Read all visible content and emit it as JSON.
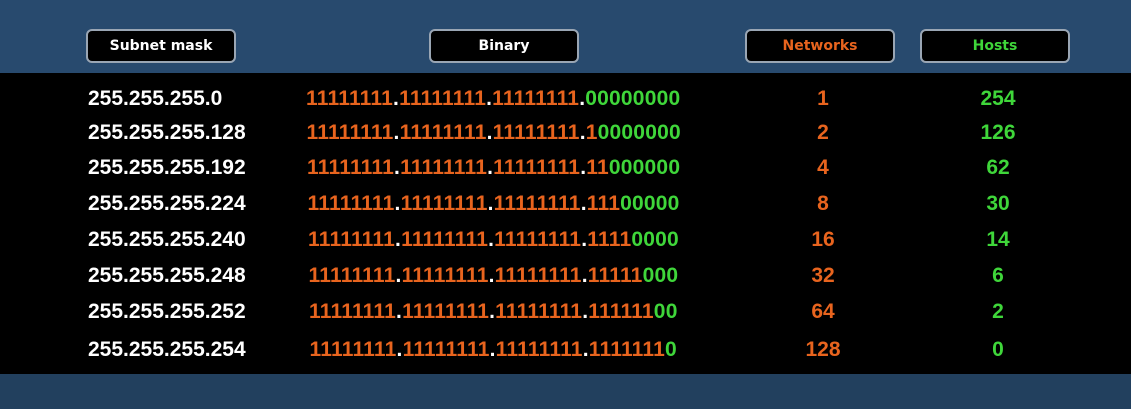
{
  "headers": {
    "mask": "Subnet mask",
    "binary": "Binary",
    "networks": "Networks",
    "hosts": "Hosts"
  },
  "colors": {
    "network_bits": "#e8641e",
    "host_bits": "#3fd63a",
    "header_bg": "#284a6e"
  },
  "rows": [
    {
      "mask": "255.255.255.0",
      "binary": "11111111.11111111.11111111.00000000",
      "networks": "1",
      "hosts": "254"
    },
    {
      "mask": "255.255.255.128",
      "binary": "11111111.11111111.11111111.10000000",
      "networks": "2",
      "hosts": "126"
    },
    {
      "mask": "255.255.255.192",
      "binary": "11111111.11111111.11111111.11000000",
      "networks": "4",
      "hosts": "62"
    },
    {
      "mask": "255.255.255.224",
      "binary": "11111111.11111111.11111111.11100000",
      "networks": "8",
      "hosts": "30"
    },
    {
      "mask": "255.255.255.240",
      "binary": "11111111.11111111.11111111.11110000",
      "networks": "16",
      "hosts": "14"
    },
    {
      "mask": "255.255.255.248",
      "binary": "11111111.11111111.11111111.11111000",
      "networks": "32",
      "hosts": "6"
    },
    {
      "mask": "255.255.255.252",
      "binary": "11111111.11111111.11111111.11111100",
      "networks": "64",
      "hosts": "2"
    },
    {
      "mask": "255.255.255.254",
      "binary": "11111111.11111111.11111111.11111110",
      "networks": "128",
      "hosts": "0"
    }
  ]
}
